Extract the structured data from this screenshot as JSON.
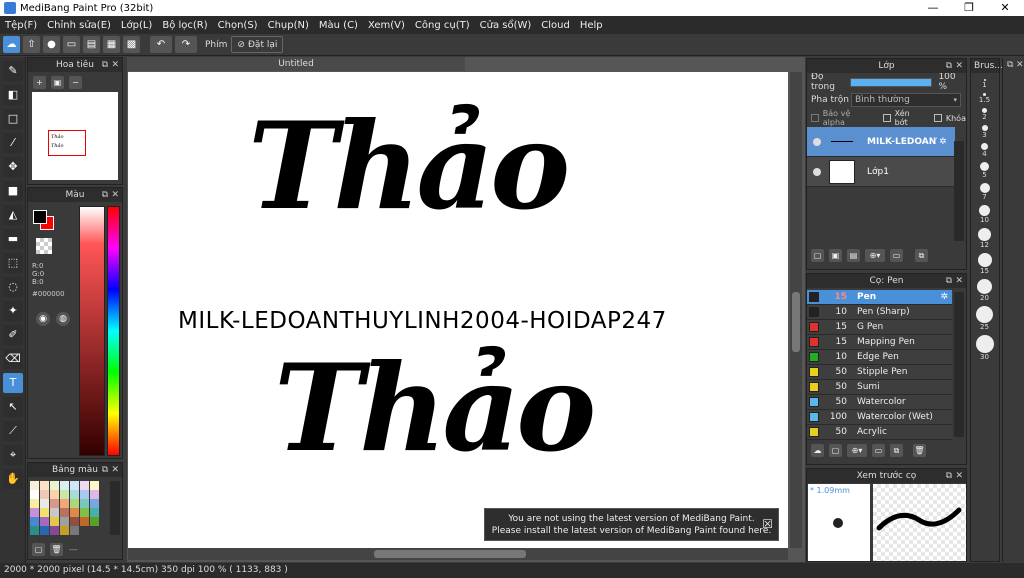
{
  "window": {
    "title": "MediBang Paint Pro (32bit)",
    "min": "—",
    "max": "❐",
    "close": "✕"
  },
  "menu": [
    "Tệp(F)",
    "Chỉnh sửa(E)",
    "Lớp(L)",
    "Bộ lọc(R)",
    "Chọn(S)",
    "Chụp(N)",
    "Màu (C)",
    "Xem(V)",
    "Công cụ(T)",
    "Cửa sổ(W)",
    "Cloud",
    "Help"
  ],
  "toolbar": {
    "phim_label": "Phím",
    "reset_label": "Đặt lại"
  },
  "navigator": {
    "title": "Hoa tiêu"
  },
  "color_panel": {
    "title": "Màu",
    "r": "R:0",
    "g": "G:0",
    "b": "B:0",
    "hex": "#000000"
  },
  "palette_panel": {
    "title": "Bảng màu",
    "dashes": "---"
  },
  "canvas": {
    "tab": "Untitled",
    "text_top": "Thảo",
    "text_middle": "MILK-LEDOANTHUYLINH2004-HOIDAP247",
    "text_bottom": "Thảo",
    "notice_line1": "You are not using the latest version of MediBang Paint.",
    "notice_line2": "Please install the latest version of MediBang Paint found here.",
    "notice_close": "☒"
  },
  "layer_panel": {
    "title": "Lớp",
    "opacity_label": "Độ trong",
    "opacity_value": "100 %",
    "opacity_fraction": 1.0,
    "blend_label": "Pha trộn",
    "blend_value": "Bình thường",
    "protect_alpha": "Bảo vệ alpha",
    "clipping": "Xén bớt",
    "lock": "Khóa",
    "layers": [
      {
        "name": "MILK-LEDOANTHUYLINH2004-HOIDAP247",
        "selected": true
      },
      {
        "name": "Lớp1",
        "selected": false
      }
    ]
  },
  "brush_panel": {
    "title": "Cọ: Pen",
    "brushes": [
      {
        "size": "15",
        "name": "Pen",
        "color": "#222222",
        "selected": true
      },
      {
        "size": "10",
        "name": "Pen (Sharp)",
        "color": "#222222",
        "selected": false
      },
      {
        "size": "15",
        "name": "G Pen",
        "color": "#e03030",
        "selected": false
      },
      {
        "size": "15",
        "name": "Mapping Pen",
        "color": "#e03030",
        "selected": false
      },
      {
        "size": "10",
        "name": "Edge Pen",
        "color": "#22b022",
        "selected": false
      },
      {
        "size": "50",
        "name": "Stipple Pen",
        "color": "#e8d020",
        "selected": false
      },
      {
        "size": "50",
        "name": "Sumi",
        "color": "#e8d020",
        "selected": false
      },
      {
        "size": "50",
        "name": "Watercolor",
        "color": "#5ab8e8",
        "selected": false
      },
      {
        "size": "100",
        "name": "Watercolor (Wet)",
        "color": "#5ab8e8",
        "selected": false
      },
      {
        "size": "50",
        "name": "Acrylic",
        "color": "#e8d020",
        "selected": false
      }
    ]
  },
  "preview_panel": {
    "title": "Xem trước cọ",
    "size": "* 1.09mm"
  },
  "brush_size_panel": {
    "title": "Brus...",
    "sizes": [
      "1",
      "1.5",
      "2",
      "3",
      "4",
      "5",
      "7",
      "10",
      "12",
      "15",
      "20",
      "25",
      "30"
    ]
  },
  "status": "2000 * 2000 pixel   (14.5 * 14.5cm)   350 dpi   100 %   ( 1133, 883 )",
  "colors": {
    "accent": "#4a90d9",
    "primary_color": "#000000",
    "secondary_color": "#ff0000"
  }
}
